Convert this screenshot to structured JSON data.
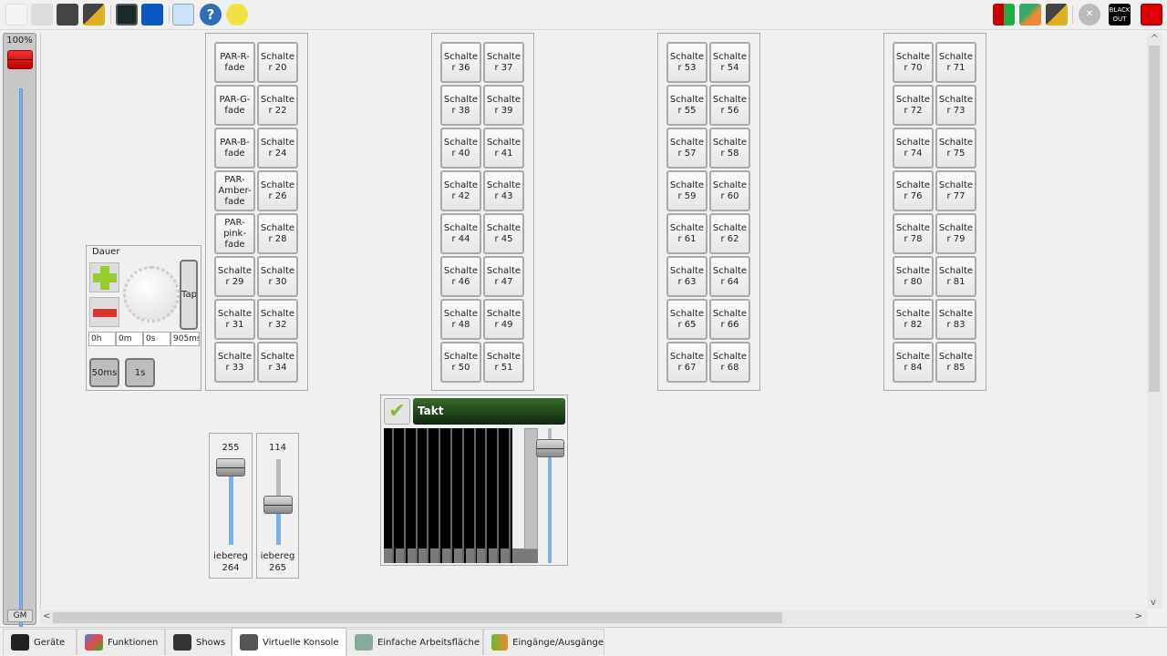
{
  "toolbar": {
    "left_icons": [
      "new-file-icon",
      "print-icon",
      "save-icon",
      "save-as-icon",
      "monitor-icon",
      "dip-switch-icon",
      "fullscreen-icon",
      "help-icon",
      "bulb-add-icon"
    ],
    "right_icons": [
      "fixture-remap-icon",
      "edit-colors-icon",
      "edit-icon",
      "stop-all-icon",
      "blackout-icon",
      "stop-red-icon"
    ],
    "blackout_label": "BLACK OUT"
  },
  "grand_master": {
    "value_label": "100%",
    "button_label": "GM",
    "level_percent": 100
  },
  "frames": [
    {
      "buttons": [
        "PAR-R-fade",
        "Schalter 20",
        "PAR-G-fade",
        "Schalter 22",
        "PAR-B-fade",
        "Schalter 24",
        "PAR-Amber-fade",
        "Schalter 26",
        "PAR-pink-fade",
        "Schalter 28",
        "Schalter 29",
        "Schalter 30",
        "Schalter 31",
        "Schalter 32",
        "Schalter 33",
        "Schalter 34"
      ]
    },
    {
      "buttons": [
        "Schalter 36",
        "Schalter 37",
        "Schalter 38",
        "Schalter 39",
        "Schalter 40",
        "Schalter 41",
        "Schalter 42",
        "Schalter 43",
        "Schalter 44",
        "Schalter 45",
        "Schalter 46",
        "Schalter 47",
        "Schalter 48",
        "Schalter 49",
        "Schalter 50",
        "Schalter 51"
      ]
    },
    {
      "buttons": [
        "Schalter 53",
        "Schalter 54",
        "Schalter 55",
        "Schalter 56",
        "Schalter 57",
        "Schalter 58",
        "Schalter 59",
        "Schalter 60",
        "Schalter 61",
        "Schalter 62",
        "Schalter 63",
        "Schalter 64",
        "Schalter 65",
        "Schalter 66",
        "Schalter 67",
        "Schalter 68"
      ]
    },
    {
      "buttons": [
        "Schalter 70",
        "Schalter 71",
        "Schalter 72",
        "Schalter 73",
        "Schalter 74",
        "Schalter 75",
        "Schalter 76",
        "Schalter 77",
        "Schalter 78",
        "Schalter 79",
        "Schalter 80",
        "Schalter 81",
        "Schalter 82",
        "Schalter 83",
        "Schalter 84",
        "Schalter 85"
      ]
    }
  ],
  "speed_dial": {
    "title": "Dauer",
    "tap_label": "Tap",
    "hours": "0h",
    "minutes": "0m",
    "seconds": "0s",
    "milliseconds": "905ms",
    "preset1": "50ms",
    "preset2": "1s"
  },
  "sliders": [
    {
      "value": "255",
      "label": "iebereg\n264",
      "level": 255
    },
    {
      "value": "114",
      "label": "iebereg\n265",
      "level": 114
    }
  ],
  "cue_list": {
    "title": "Takt",
    "steps": 11,
    "fader_level_percent": 85
  },
  "tabs": [
    {
      "label": "Geräte",
      "icon": "fixture-spotlight-icon"
    },
    {
      "label": "Funktionen",
      "icon": "functions-icon"
    },
    {
      "label": "Shows",
      "icon": "clapperboard-icon"
    },
    {
      "label": "Virtuelle Konsole",
      "icon": "virtual-console-icon",
      "active": true
    },
    {
      "label": "Einfache Arbeitsfläche",
      "icon": "simple-desk-icon"
    },
    {
      "label": "Eingänge/Ausgänge",
      "icon": "input-output-icon"
    }
  ]
}
